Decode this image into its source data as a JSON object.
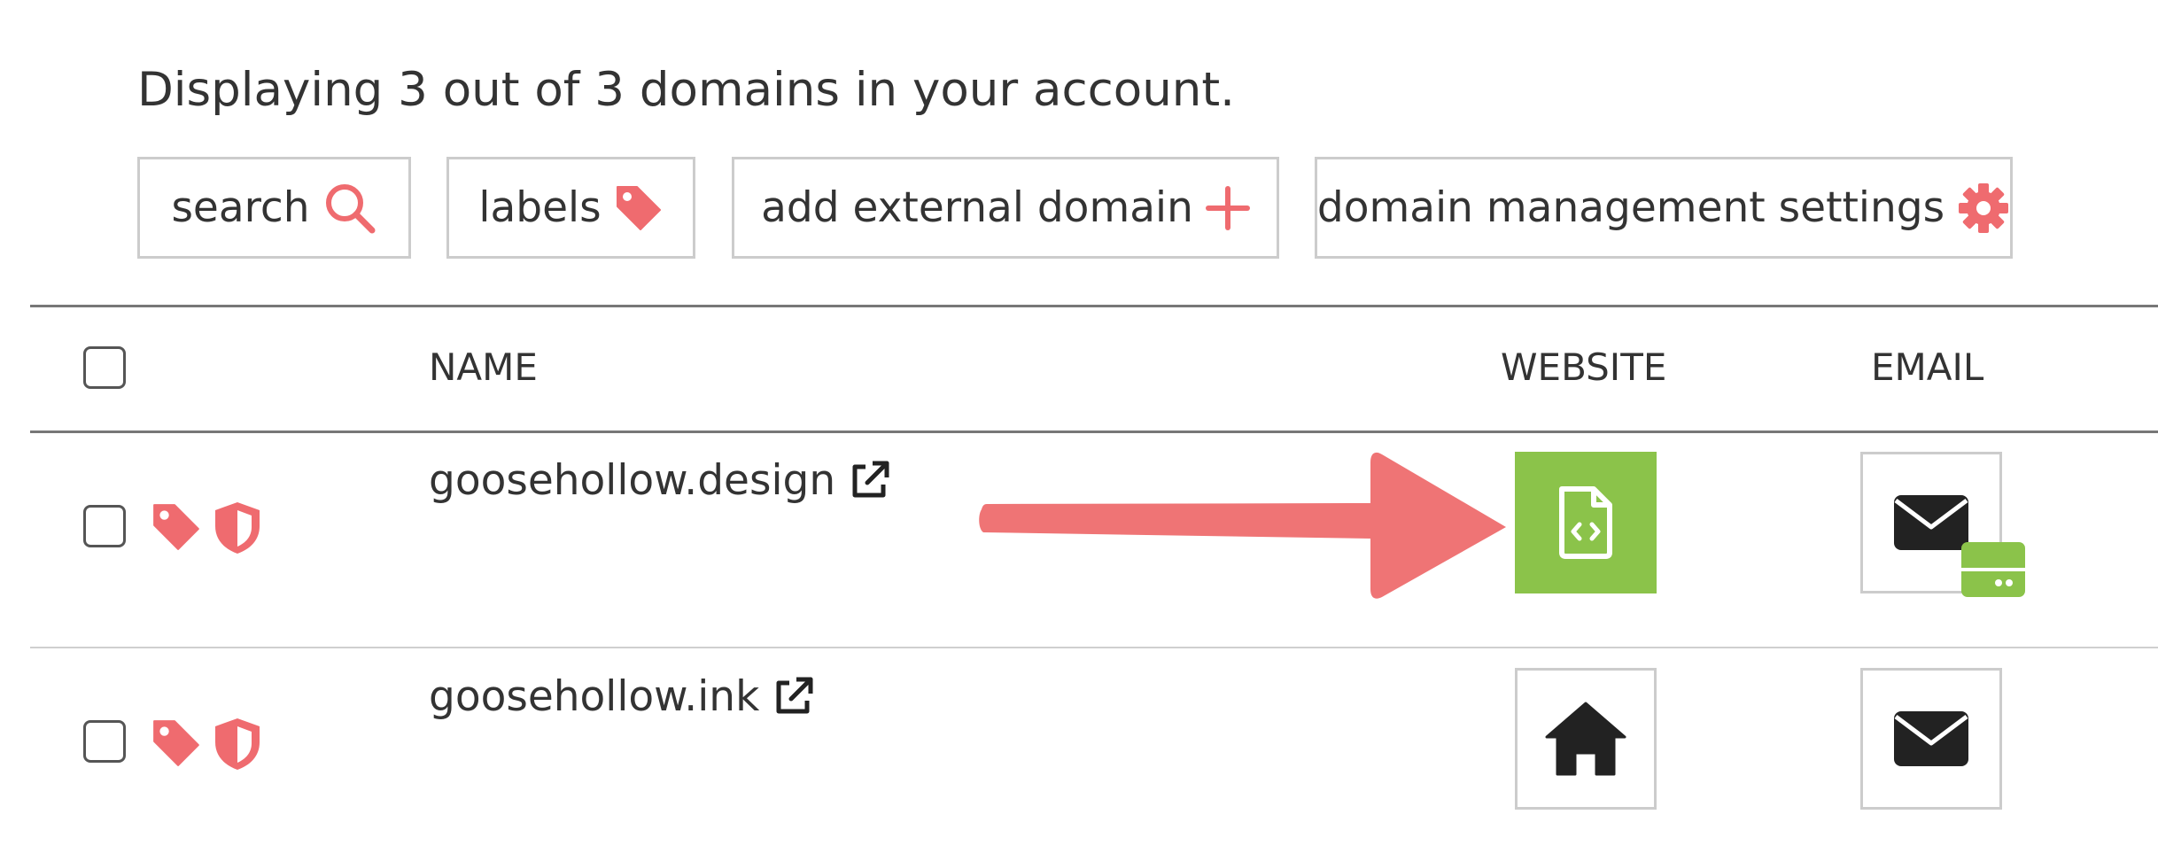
{
  "summary": "Displaying 3 out of 3 domains in your account.",
  "toolbar": {
    "search_label": "search",
    "labels_label": "labels",
    "add_external_label": "add external domain",
    "settings_label": "domain management settings"
  },
  "table": {
    "headers": {
      "name": "NAME",
      "website": "WEBSITE",
      "email": "EMAIL"
    },
    "rows": [
      {
        "name": "goosehollow.design",
        "website_icon": "code-file-icon",
        "website_active": true,
        "email_icon": "envelope-icon",
        "email_badge_icon": "server-icon"
      },
      {
        "name": "goosehollow.ink",
        "website_icon": "home-icon",
        "website_active": false,
        "email_icon": "envelope-icon"
      }
    ]
  },
  "colors": {
    "accent": "#ef6b6f",
    "active_green": "#8bc34a",
    "text": "#333333",
    "icon_dark": "#222222",
    "border": "#cccccc",
    "annotation_arrow": "#ef7475"
  }
}
